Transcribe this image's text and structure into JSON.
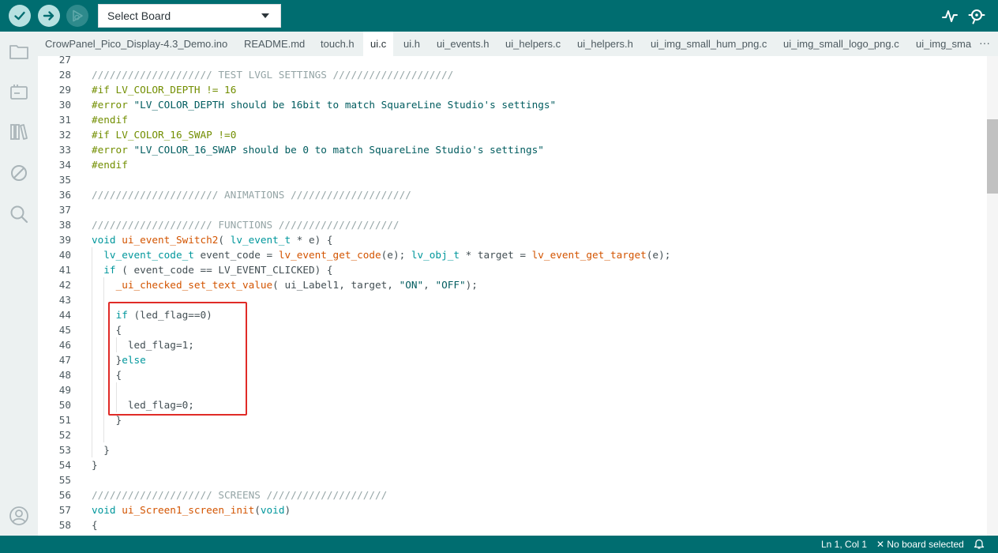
{
  "toolbar": {
    "verify_icon": "check-icon",
    "upload_icon": "arrow-right-icon",
    "debug_icon": "debug-play-icon",
    "board_select": "Select Board",
    "plotter_icon": "serial-plotter-icon",
    "monitor_icon": "serial-monitor-icon"
  },
  "tabs": [
    {
      "label": "CrowPanel_Pico_Display-4.3_Demo.ino",
      "active": false
    },
    {
      "label": "README.md",
      "active": false
    },
    {
      "label": "touch.h",
      "active": false
    },
    {
      "label": "ui.c",
      "active": true
    },
    {
      "label": "ui.h",
      "active": false
    },
    {
      "label": "ui_events.h",
      "active": false
    },
    {
      "label": "ui_helpers.c",
      "active": false
    },
    {
      "label": "ui_helpers.h",
      "active": false
    },
    {
      "label": "ui_img_small_hum_png.c",
      "active": false
    },
    {
      "label": "ui_img_small_logo_png.c",
      "active": false
    },
    {
      "label": "ui_img_sma",
      "active": false
    }
  ],
  "tabs_more": "···",
  "code_lines": [
    {
      "n": "27",
      "t": ""
    },
    {
      "n": "28",
      "t": "//////////////////// TEST LVGL SETTINGS ////////////////////"
    },
    {
      "n": "29",
      "t": "#if LV_COLOR_DEPTH != 16"
    },
    {
      "n": "30",
      "t": "#error \"LV_COLOR_DEPTH should be 16bit to match SquareLine Studio's settings\""
    },
    {
      "n": "31",
      "t": "#endif"
    },
    {
      "n": "32",
      "t": "#if LV_COLOR_16_SWAP !=0"
    },
    {
      "n": "33",
      "t": "#error \"LV_COLOR_16_SWAP should be 0 to match SquareLine Studio's settings\""
    },
    {
      "n": "34",
      "t": "#endif"
    },
    {
      "n": "35",
      "t": ""
    },
    {
      "n": "36",
      "t": "///////////////////// ANIMATIONS ////////////////////"
    },
    {
      "n": "37",
      "t": ""
    },
    {
      "n": "38",
      "t": "//////////////////// FUNCTIONS ////////////////////"
    },
    {
      "n": "39",
      "t": "void ui_event_Switch2( lv_event_t * e) {"
    },
    {
      "n": "40",
      "t": "  lv_event_code_t event_code = lv_event_get_code(e); lv_obj_t * target = lv_event_get_target(e);"
    },
    {
      "n": "41",
      "t": "  if ( event_code == LV_EVENT_CLICKED) {"
    },
    {
      "n": "42",
      "t": "    _ui_checked_set_text_value( ui_Label1, target, \"ON\", \"OFF\");"
    },
    {
      "n": "43",
      "t": ""
    },
    {
      "n": "44",
      "t": "    if (led_flag==0)"
    },
    {
      "n": "45",
      "t": "    {"
    },
    {
      "n": "46",
      "t": "      led_flag=1;"
    },
    {
      "n": "47",
      "t": "    }else"
    },
    {
      "n": "48",
      "t": "    {"
    },
    {
      "n": "49",
      "t": ""
    },
    {
      "n": "50",
      "t": "      led_flag=0;"
    },
    {
      "n": "51",
      "t": "    }"
    },
    {
      "n": "52",
      "t": ""
    },
    {
      "n": "53",
      "t": "  }"
    },
    {
      "n": "54",
      "t": "}"
    },
    {
      "n": "55",
      "t": ""
    },
    {
      "n": "56",
      "t": "//////////////////// SCREENS ////////////////////"
    },
    {
      "n": "57",
      "t": "void ui_Screen1_screen_init(void)"
    },
    {
      "n": "58",
      "t": "{"
    }
  ],
  "statusbar": {
    "position": "Ln 1, Col 1",
    "board": "No board selected",
    "bell_icon": "bell-icon"
  },
  "colors": {
    "toolbar_bg": "#006d70",
    "highlight_border": "#e02b27",
    "comment": "#95a5a6",
    "preprocessor": "#728e00",
    "keyword": "#00979c",
    "function": "#d35400"
  }
}
